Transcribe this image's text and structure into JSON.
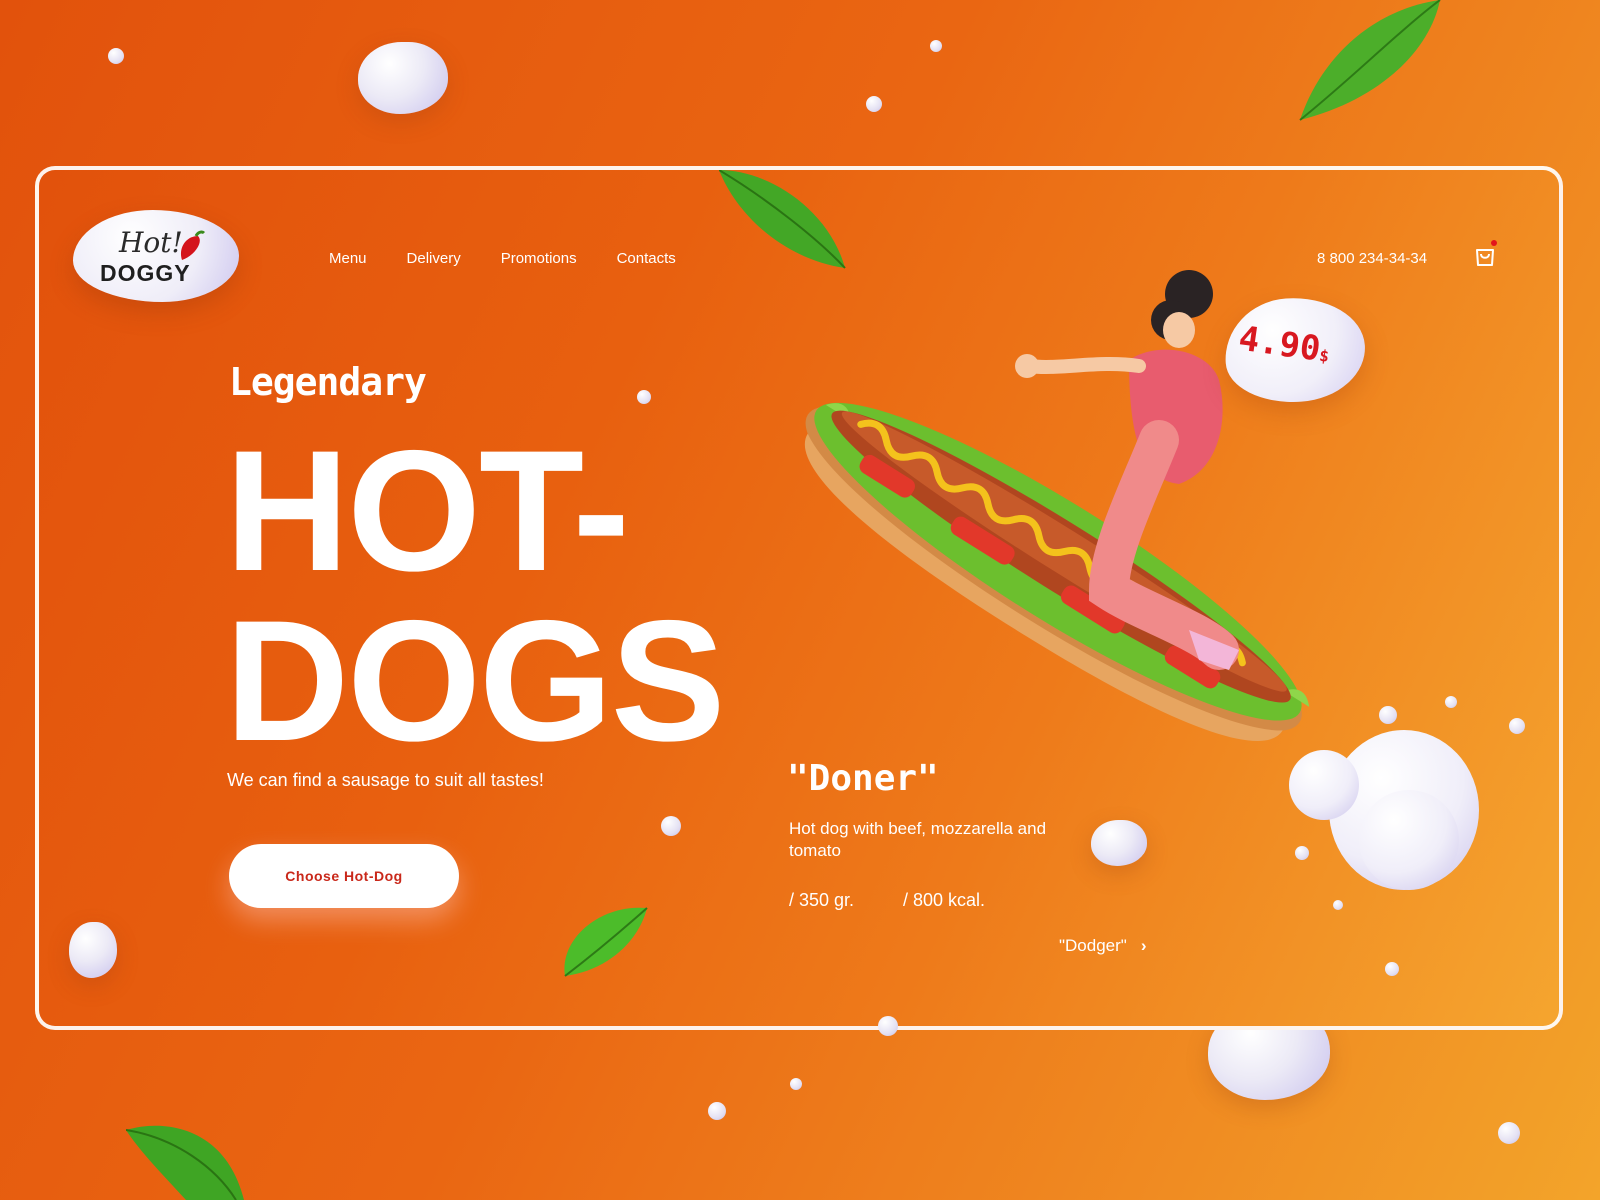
{
  "brand": {
    "logo_top": "Hot!",
    "logo_bottom": "DOGGY"
  },
  "nav": {
    "items": [
      {
        "label": "Menu"
      },
      {
        "label": "Delivery"
      },
      {
        "label": "Promotions"
      },
      {
        "label": "Contacts"
      }
    ]
  },
  "header": {
    "phone": "8 800 234-34-34",
    "cart_icon": "shopping-bag-icon"
  },
  "hero": {
    "kicker": "Legendary",
    "title_line1": "HOT-",
    "title_line2": "DOGS",
    "tagline": "We can find a sausage to suit all tastes!",
    "cta_label": "Choose Hot-Dog"
  },
  "product": {
    "name": "\"Doner\"",
    "description": "Hot dog with beef, mozzarella and tomato",
    "weight": "/ 350 gr.",
    "calories": "/ 800 kcal.",
    "price": "4.90",
    "currency": "$",
    "next_label": "\"Dodger\""
  },
  "colors": {
    "accent": "#e3141b",
    "bg_start": "#e2520c",
    "bg_end": "#f5a52f",
    "white": "#ffffff"
  }
}
